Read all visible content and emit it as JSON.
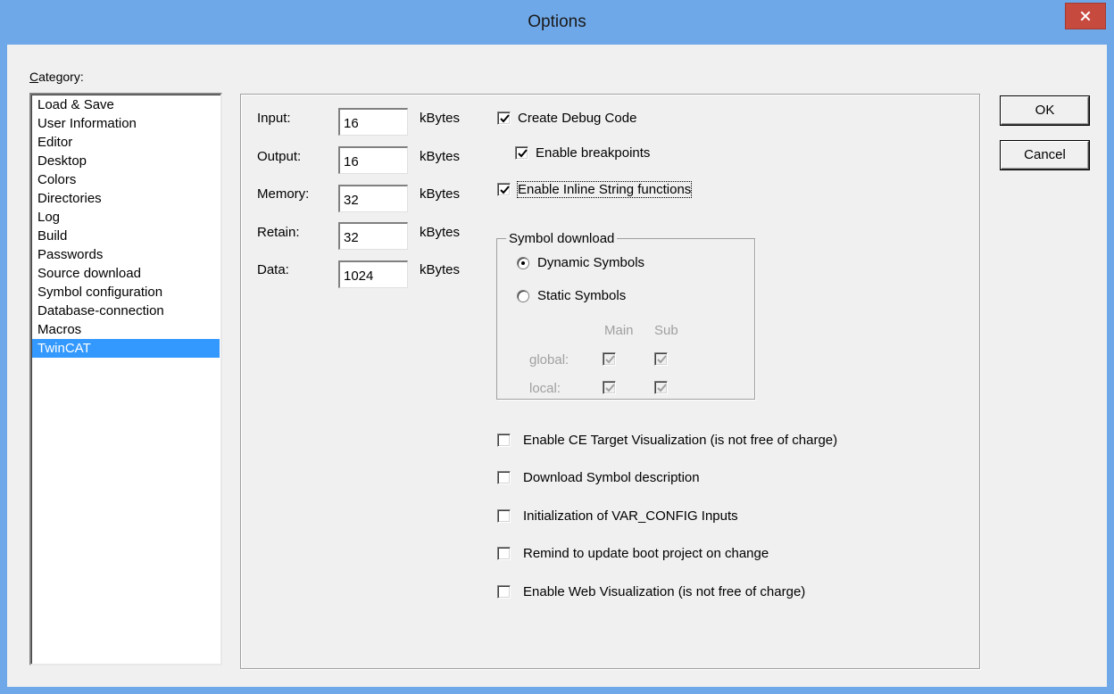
{
  "window": {
    "title": "Options",
    "close_icon": "close-icon"
  },
  "category": {
    "label_prefix": "C",
    "label_rest": "ategory:",
    "items": [
      "Load & Save",
      "User Information",
      "Editor",
      "Desktop",
      "Colors",
      "Directories",
      "Log",
      "Build",
      "Passwords",
      "Source download",
      "Symbol configuration",
      "Database-connection",
      "Macros",
      "TwinCAT"
    ],
    "selected": "TwinCAT"
  },
  "memory": {
    "input_label": "Input:",
    "input_value": "16",
    "output_label": "Output:",
    "output_value": "16",
    "memory_label": "Memory:",
    "memory_value": "32",
    "retain_label": "Retain:",
    "retain_value": "32",
    "data_label": "Data:",
    "data_value": "1024",
    "unit": "kBytes"
  },
  "options": {
    "create_debug_code": "Create Debug Code",
    "enable_breakpoints": "Enable breakpoints",
    "enable_inline_string": "Enable Inline String functions",
    "enable_ce_target": "Enable CE Target Visualization (is not free of charge)",
    "download_symbol_desc": "Download Symbol description",
    "init_var_config": "Initialization of VAR_CONFIG Inputs",
    "remind_boot_project": "Remind to update boot project on change",
    "enable_web_vis": "Enable Web Visualization (is not free of charge)"
  },
  "symbol_download": {
    "title": "Symbol download",
    "dynamic": "Dynamic Symbols",
    "static": "Static Symbols",
    "col_main": "Main",
    "col_sub": "Sub",
    "row_global": "global:",
    "row_local": "local:"
  },
  "buttons": {
    "ok": "OK",
    "cancel": "Cancel"
  }
}
